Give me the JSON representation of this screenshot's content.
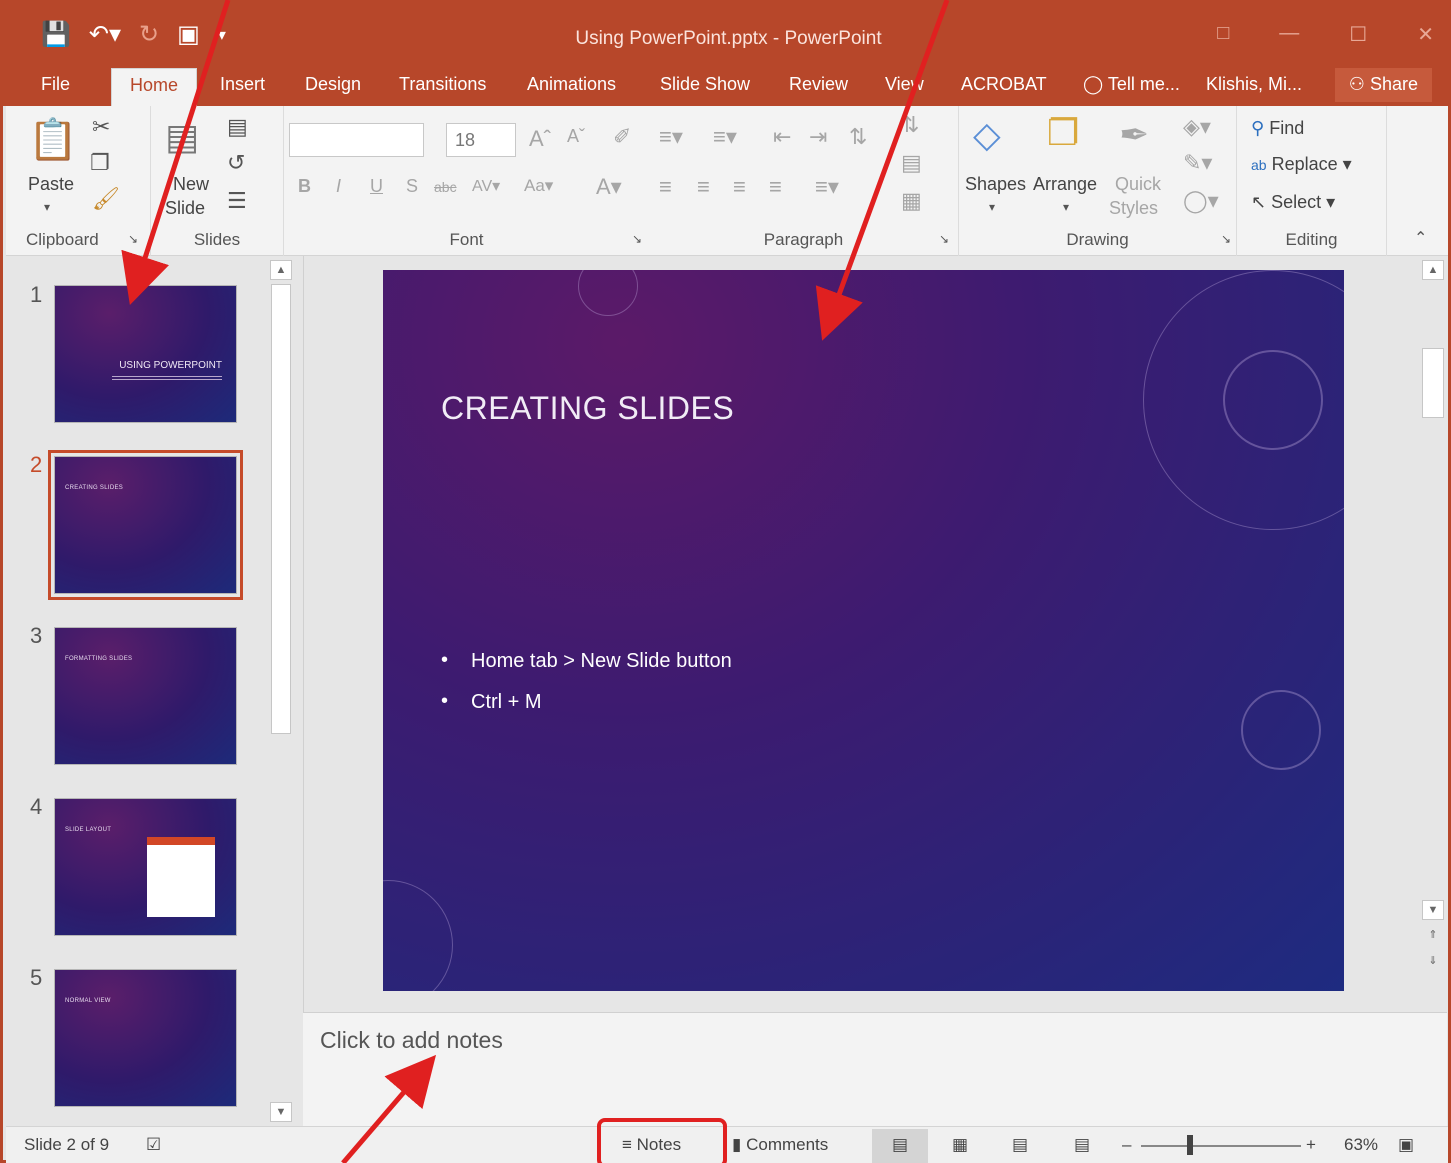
{
  "window": {
    "title": "Using PowerPoint.pptx - PowerPoint",
    "accent": "#b7472a"
  },
  "tabs": [
    "File",
    "Home",
    "Insert",
    "Design",
    "Transitions",
    "Animations",
    "Slide Show",
    "Review",
    "View",
    "ACROBAT"
  ],
  "tellme": "Tell me...",
  "user": "Klishis, Mi...",
  "share": "Share",
  "ribbon": {
    "clipboard": {
      "label": "Clipboard",
      "paste": "Paste"
    },
    "slides": {
      "label": "Slides",
      "new_slide_1": "New",
      "new_slide_2": "Slide"
    },
    "font": {
      "label": "Font",
      "font_name": "",
      "font_size": "18"
    },
    "paragraph": {
      "label": "Paragraph"
    },
    "drawing": {
      "label": "Drawing",
      "shapes": "Shapes",
      "arrange": "Arrange",
      "quick_1": "Quick",
      "quick_2": "Styles"
    },
    "editing": {
      "label": "Editing",
      "find": "Find",
      "replace": "Replace",
      "select": "Select"
    }
  },
  "thumbnails": {
    "numbers": [
      "1",
      "2",
      "3",
      "4",
      "5"
    ],
    "slide1_title": "USING POWERPOINT",
    "slide2_title": "CREATING SLIDES",
    "slide3_title": "FORMATTING SLIDES",
    "slide4_title": "SLIDE LAYOUT",
    "slide5_title": "NORMAL VIEW"
  },
  "slide": {
    "title": "CREATING SLIDES",
    "bullets": [
      "Home tab > New Slide button",
      "Ctrl + M"
    ]
  },
  "notes": {
    "placeholder": "Click to add notes"
  },
  "status": {
    "slide_info": "Slide 2 of 9",
    "notes": "Notes",
    "comments": "Comments",
    "zoom": "63%",
    "zoom_level": 0.63
  }
}
